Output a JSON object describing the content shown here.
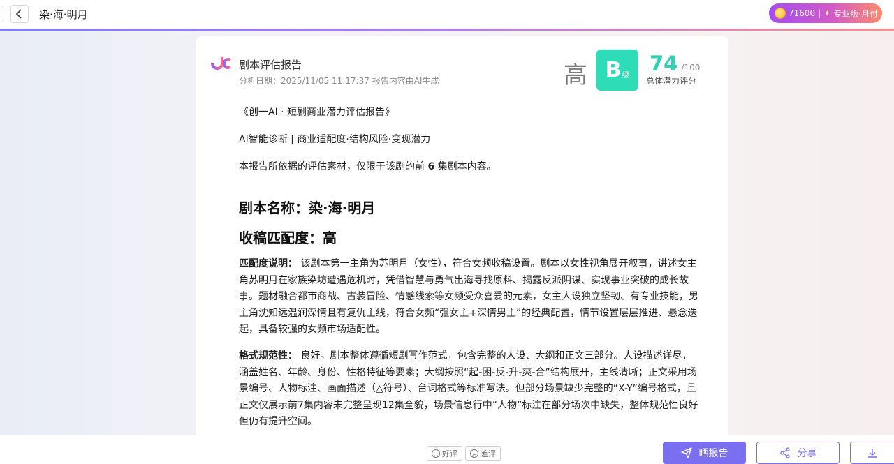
{
  "header": {
    "title": "染·海·明月",
    "coins": "71600",
    "separator": "|",
    "plan": "专业版·月付"
  },
  "report": {
    "title": "剧本评估报告",
    "date_line": "分析日期：2025/11/05 11:17:37 报告内容由AI生成",
    "level": "高",
    "grade": "B",
    "grade_unit": "级",
    "score": "74",
    "score_max": "/100",
    "score_label": "总体潜力评分"
  },
  "content": {
    "line1": "《创一AI · 短剧商业潜力评估报告》",
    "line2": "AI智能诊断 | 商业适配度·结构风险·变现潜力",
    "line3_prefix": "本报告所依据的评估素材，仅限于该剧的前 ",
    "line3_num": "6",
    "line3_suffix": " 集剧本内容。",
    "heading_name": "剧本名称：染·海·明月",
    "heading_match": "收稿匹配度：高",
    "para1_label": "匹配度说明：",
    "para1_text": "该剧本第一主角为苏明月（女性），符合女频收稿设置。剧本以女性视角展开叙事，讲述女主角苏明月在家族染坊遭遇危机时，凭借智慧与勇气出海寻找原料、揭露反派阴谋、实现事业突破的成长故事。题材融合都市商战、古装冒险、情感线索等女频受众喜爱的元素，女主人设独立坚韧、有专业技能，男主角沈知远温润深情且有复仇主线，符合女频“强女主+深情男主”的经典配置，情节设置层层推进、悬念迭起，具备较强的女频市场适配性。",
    "para2_label": "格式规范性：",
    "para2_text": "良好。剧本整体遵循短剧写作范式，包含完整的人设、大纲和正文三部分。人设描述详尽，涵盖姓名、年龄、身份、性格特征等要素；大纲按照“起-困-反-升-爽-合”结构展开，主线清晰；正文采用场景编号、人物标注、画面描述（△符号）、台词格式等标准写法。但部分场景缺少完整的“X-Y”编号格式，且正文仅展示前7集内容未完整呈现12集全貌，场景信息行中“人物”标注在部分场次中缺失，整体规范性良好但仍有提升空间。"
  },
  "footer": {
    "good_label": "好评",
    "bad_label": "差评",
    "share_report_label": "晒报告",
    "share_label": "分享"
  },
  "colors": {
    "accent": "#7a6ff0",
    "grade_bg": "#2fdcb8",
    "score": "#2fd3b3"
  }
}
